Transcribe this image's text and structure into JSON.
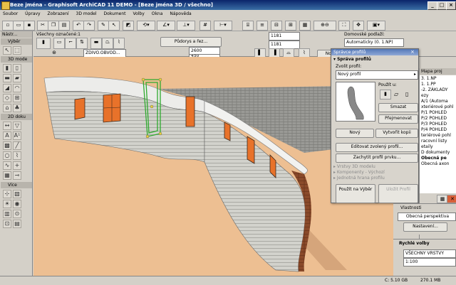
{
  "window": {
    "title": "Beze jména - Graphisoft ArchiCAD 11 DEMO - [Beze jména 3D / všechno]"
  },
  "menubar": [
    "Soubor",
    "Úpravy",
    "Zobrazení",
    "3D model",
    "Dokument",
    "Volby",
    "Okna",
    "Nápověda"
  ],
  "infobox": {
    "selection": "Všechny označené:1",
    "layers_button": "Půdorys a řez...",
    "value1": "1181",
    "value2": "1181",
    "home_story_label": "Domovské podlaží:",
    "home_story_value": "Automaticky (0. 1.NP)",
    "profile_select": "ZDIVO.OBVOD...",
    "dim1": "2600",
    "dim2": "450",
    "profile_button": "Nový profil"
  },
  "toolbox": {
    "title": "Nástr...",
    "select_section": "Výběr",
    "model_section": "3D mode",
    "doc_section": "2D doku",
    "more_section": "Více"
  },
  "dialog": {
    "title": "Správce profilů",
    "section": "Správa profilů",
    "choose_label": "Zvolit profil:",
    "profile_value": "Nový profil",
    "use_label": "Použít u:",
    "delete_button": "Smazat",
    "rename_button": "Přejmenovat",
    "new_button": "Nový",
    "copy_button": "Vytvořit kopii",
    "edit_button": "Editovat zvolený profil...",
    "capture_button": "Zachytit profil prvku...",
    "collapsed1": "Vrstvy 3D modelu",
    "collapsed2": "Komponenty - Výchozí",
    "collapsed3": "Jednotná hrana profilu",
    "apply_button": "Použít na Výběr",
    "store_button": "Uložit Profil"
  },
  "navigator": {
    "title": "Mapa proj",
    "items": [
      "3. 1.NP",
      "1. 1.PP",
      "-2. ZÁKLADY",
      "ezy",
      "A/1 (Automa",
      "xteriérové pohl",
      "P/1 POHLED",
      "P/2 POHLED",
      "P/3 POHLED",
      "P/4 POHLED",
      "teriérové pohl",
      "racovní listy",
      "etaily",
      "D dokumenty",
      "Obecná pe",
      "Obecná axon"
    ]
  },
  "properties": {
    "title": "Vlastnosti",
    "value": "Obecná perspektiva",
    "settings_button": "Nastavení..."
  },
  "quick_options": {
    "title": "Rychlé volby",
    "layers_value": "VŠECHNY VRSTVY",
    "scale_value": "1:100"
  },
  "status": {
    "disk": "C: 5.10 GB",
    "memory": "270.1 MB"
  },
  "colors": {
    "wall": "#cfcfc9",
    "background": "#edbf92",
    "window": "#e8722a",
    "brick": "#8a4a2a"
  }
}
